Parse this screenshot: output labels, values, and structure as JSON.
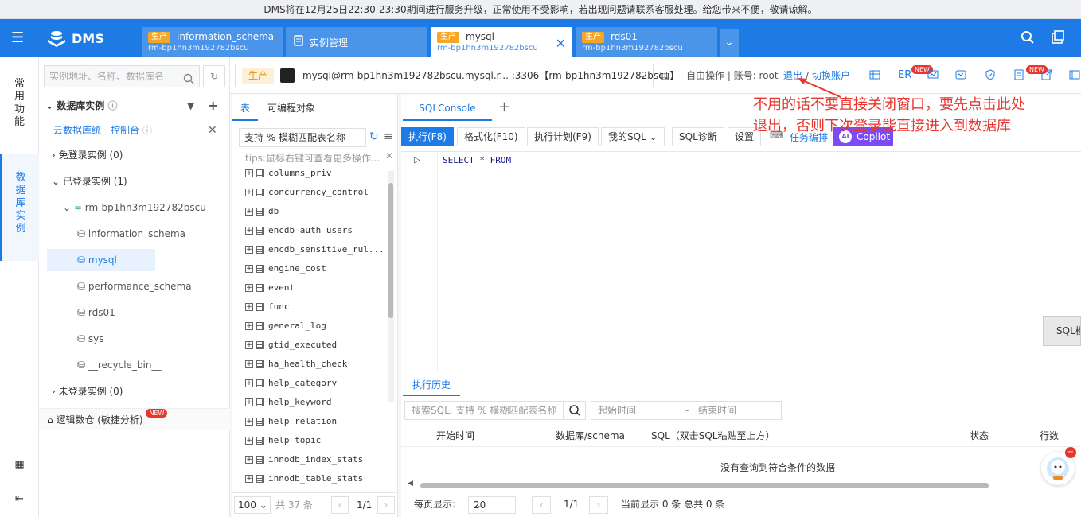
{
  "notice": "DMS将在12月25日22:30-23:30期间进行服务升级，正常使用不受影响，若出现问题请联系客服处理。给您带来不便，敬请谅解。",
  "brand": "DMS",
  "tabs": [
    {
      "env": "生产",
      "name": "information_schema",
      "sub": "rm-bp1hn3m192782bscu"
    },
    {
      "name": "实例管理"
    },
    {
      "env": "生产",
      "name": "mysql",
      "sub": "rm-bp1hn3m192782bscu"
    },
    {
      "env": "生产",
      "name": "rds01",
      "sub": "rm-bp1hn3m192782bscu"
    }
  ],
  "leftnav": {
    "common": "常用功能",
    "instances": "数据库实例"
  },
  "sidebar": {
    "search_placeholder": "实例地址、名称、数据库名",
    "section_title": "数据库实例",
    "console_link": "云数据库统一控制台",
    "free_login": "免登录实例 (0)",
    "logged_in": "已登录实例 (1)",
    "instance": "rm-bp1hn3m192782bscu",
    "dbs": [
      "information_schema",
      "mysql",
      "performance_schema",
      "rds01",
      "sys",
      "__recycle_bin__"
    ],
    "not_logged": "未登录实例 (0)",
    "logic": "逻辑数仓 (敏捷分析)",
    "new_badge": "NEW"
  },
  "header": {
    "env": "生产",
    "connection": "mysql@rm-bp1hn3m192782bscu.mysql.r... :3306【rm-bp1hn3m192782bscu】",
    "mode": "自由操作 | 账号: root",
    "logout": "退出",
    "sep": "/",
    "switch": "切换账户",
    "er": "ER",
    "new1": "NEW",
    "new2": "NEW"
  },
  "objects": {
    "tab_tables": "表",
    "tab_prog": "可编程对象",
    "search": "支持 % 模糊匹配表名称",
    "tip": "tips:鼠标右键可查看更多操作...",
    "tables": [
      "columns_priv",
      "concurrency_control",
      "db",
      "encdb_auth_users",
      "encdb_sensitive_rul...",
      "engine_cost",
      "event",
      "func",
      "general_log",
      "gtid_executed",
      "ha_health_check",
      "help_category",
      "help_keyword",
      "help_relation",
      "help_topic",
      "innodb_index_stats",
      "innodb_table_stats"
    ],
    "page_size": "100",
    "total": "共 37 条",
    "page": "1/1"
  },
  "console": {
    "tab": "SQLConsole",
    "plus": "+",
    "buttons": {
      "run": "执行(F8)",
      "format": "格式化(F10)",
      "plan": "执行计划(F9)",
      "mysql": "我的SQL",
      "diag": "SQL诊断",
      "settings": "设置",
      "task": "任务编排",
      "copilot": "Copilot",
      "ai": "AI"
    },
    "sql_kw1": "SELECT",
    "sql_rest": "* FROM",
    "side": "SQL模"
  },
  "history": {
    "tab": "执行历史",
    "search": "搜索SQL, 支持 % 模糊匹配表名称",
    "start": "起始时间",
    "dash": "-",
    "end": "结束时间",
    "cols": [
      "开始时间",
      "数据库/schema",
      "SQL（双击SQL粘贴至上方）",
      "状态",
      "行数"
    ],
    "empty": "没有查询到符合条件的数据",
    "per_page_label": "每页显示:",
    "per_page": "20",
    "page": "1/1",
    "summary": "当前显示 0 条 总共 0 条"
  },
  "annotation": [
    "不用的话不要直接关闭窗口，要先点击此处",
    "退出，否则下次登录能直接进入到数据库"
  ],
  "colors": {
    "primary": "#1e7be6",
    "annotation": "#e8352e",
    "env_badge": "#f5a623"
  }
}
